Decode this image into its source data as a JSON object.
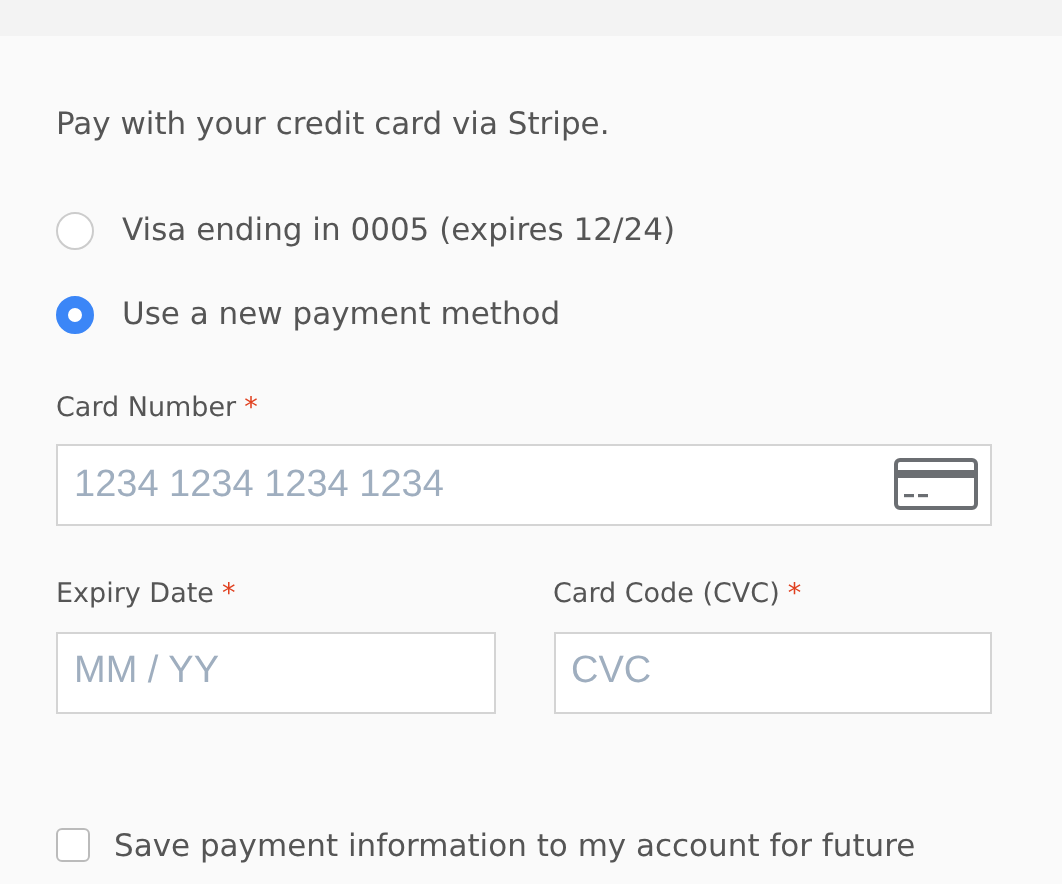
{
  "intro": "Pay with your credit card via Stripe.",
  "payment_options": [
    {
      "label": "Visa ending in 0005 (expires 12/24)",
      "selected": false
    },
    {
      "label": "Use a new payment method",
      "selected": true
    }
  ],
  "card_number": {
    "label": "Card Number",
    "required_mark": "*",
    "placeholder": "1234 1234 1234 1234"
  },
  "expiry_date": {
    "label": "Expiry Date",
    "required_mark": "*",
    "placeholder": "MM / YY"
  },
  "card_code": {
    "label": "Card Code (CVC)",
    "required_mark": "*",
    "placeholder": "CVC"
  },
  "save_payment": {
    "label": "Save payment information to my account for future",
    "checked": false
  }
}
